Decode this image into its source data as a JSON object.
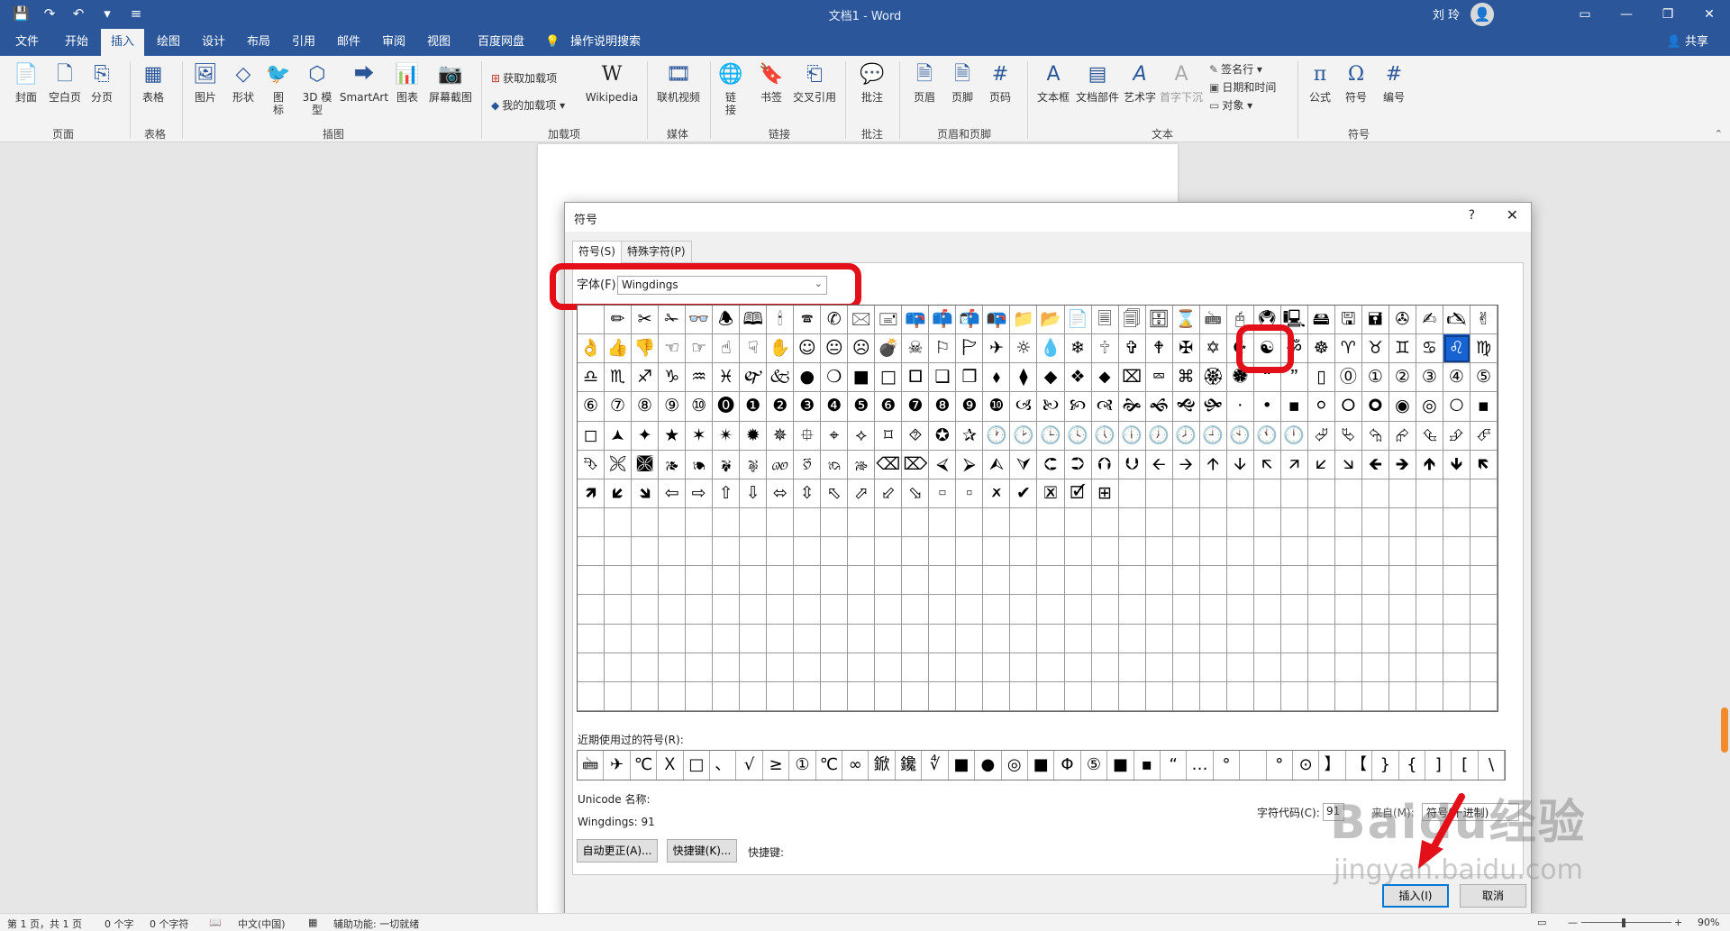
{
  "titlebar": {
    "qat": [
      "💾",
      "↷",
      "↶",
      "▾",
      "≡"
    ],
    "doc_title": "文档1  -  Word",
    "user": "刘 玲",
    "avatar_icon": "👤",
    "window_buttons": [
      "▭",
      "—",
      "❐",
      "✕"
    ]
  },
  "tabs": [
    {
      "label": "文件"
    },
    {
      "label": "开始"
    },
    {
      "label": "插入"
    },
    {
      "label": "绘图"
    },
    {
      "label": "设计"
    },
    {
      "label": "布局"
    },
    {
      "label": "引用"
    },
    {
      "label": "邮件"
    },
    {
      "label": "审阅"
    },
    {
      "label": "视图"
    },
    {
      "label": "百度网盘"
    }
  ],
  "tell_me": "操作说明搜索",
  "share": "共享",
  "ribbon": {
    "buttons": {
      "cover": "封面",
      "blank": "空白页",
      "break": "分页",
      "table": "表格",
      "picture": "图片",
      "shapes": "形状",
      "icons": "图\n标",
      "model3d": "3D 模\n型",
      "smartart": "SmartArt",
      "chart": "图表",
      "screenshot": "屏幕截图",
      "get_addins": "获取加载项",
      "my_addins": "我的加载项",
      "wikipedia": "Wikipedia",
      "online_video": "联机视频",
      "link": "链\n接",
      "bookmark": "书签",
      "crossref": "交叉引用",
      "comment": "批注",
      "header": "页眉",
      "footer": "页脚",
      "pagenum": "页码",
      "textbox": "文本框",
      "quickparts": "文档部件",
      "wordart": "艺术字",
      "dropcap": "首字下沉",
      "signature": "签名行",
      "datetime": "日期和时间",
      "object": "对象",
      "equation": "公式",
      "symbol": "符号",
      "number": "编号"
    },
    "groups": {
      "pages": "页面",
      "tables": "表格",
      "illustrations": "插图",
      "addins": "加载项",
      "media": "媒体",
      "links": "链接",
      "comments": "批注",
      "headerfooter": "页眉和页脚",
      "text": "文本",
      "symbols": "符号"
    }
  },
  "dialog": {
    "title": "符号",
    "help": "?",
    "close": "✕",
    "tabs": [
      "符号(S)",
      "特殊字符(P)"
    ],
    "font_label": "字体(F):",
    "font_value": "Wingdings",
    "symbols": [
      "",
      "✏",
      "✂",
      "✁",
      "👓",
      "🕭",
      "🕮",
      "🕯",
      "🕿",
      "✆",
      "🖂",
      "🖃",
      "📪",
      "📫",
      "📬",
      "📭",
      "📁",
      "📂",
      "📄",
      "🗏",
      "🗐",
      "🗄",
      "⌛",
      "🖮",
      "🖰",
      "🖲",
      "🖳",
      "🖴",
      "🖫",
      "🖬",
      "✇",
      "✍",
      "🖎",
      "✌",
      "👌",
      "👍",
      "👎",
      "☜",
      "☞",
      "☝",
      "☟",
      "✋",
      "☺",
      "😐",
      "☹",
      "💣",
      "☠",
      "⚐",
      "🏱",
      "✈",
      "☼",
      "💧",
      "❄",
      "🕆",
      "✞",
      "🕈",
      "✠",
      "✡",
      "☪",
      "☯",
      "ॐ",
      "☸",
      "♈",
      "♉",
      "♊",
      "♋",
      "♌",
      "♍",
      "♎",
      "♏",
      "♐",
      "♑",
      "♒",
      "♓",
      "🙰",
      "🙵",
      "●",
      "❍",
      "■",
      "□",
      "🞐",
      "❑",
      "❒",
      "⬧",
      "⧫",
      "◆",
      "❖",
      "⬥",
      "⌧",
      "⮹",
      "⌘",
      "🏵",
      "🏶",
      "🙶",
      "🙷",
      "▯",
      "⓪",
      "①",
      "②",
      "③",
      "④",
      "⑤",
      "⑥",
      "⑦",
      "⑧",
      "⑨",
      "⑩",
      "⓿",
      "❶",
      "❷",
      "❸",
      "❹",
      "❺",
      "❻",
      "❼",
      "❽",
      "❾",
      "❿",
      "🙢",
      "🙠",
      "🙡",
      "🙣",
      "🙞",
      "🙜",
      "🙝",
      "🙟",
      "·",
      "•",
      "▪",
      "⚪",
      "🞆",
      "🞈",
      "◉",
      "◎",
      "🞅",
      "▪",
      "◻",
      "🟂",
      "✦",
      "★",
      "✶",
      "✴",
      "✹",
      "✵",
      "⯐",
      "⌖",
      "⟡",
      "⌑",
      "⯑",
      "✪",
      "✰",
      "🕐",
      "🕑",
      "🕒",
      "🕓",
      "🕔",
      "🕕",
      "🕖",
      "🕗",
      "🕘",
      "🕙",
      "🕚",
      "🕛",
      "⮰",
      "⮱",
      "⮲",
      "⮳",
      "⮴",
      "⮵",
      "⮶",
      "⮷",
      "🙪",
      "🙫",
      "🙕",
      "🙔",
      "🙗",
      "🙖",
      "🙐",
      "🙑",
      "🙒",
      "🙓",
      "⌫",
      "⌦",
      "⮘",
      "⮚",
      "⮙",
      "⮛",
      "⮈",
      "⮊",
      "⮉",
      "⮋",
      "🡨",
      "🡪",
      "🡩",
      "🡫",
      "🡬",
      "🡭",
      "🡯",
      "🡮",
      "🡸",
      "🡺",
      "🡹",
      "🡻",
      "🡼",
      "🡽",
      "🡿",
      "🡾",
      "⇦",
      "⇨",
      "⇧",
      "⇩",
      "⬄",
      "⇳",
      "⬁",
      "⬀",
      "⬃",
      "⬂",
      "🢬",
      "🢭",
      "🗶",
      "✔",
      "🗷",
      "🗹",
      "⊞"
    ],
    "selected_index": 66,
    "recent_label": "近期使用过的符号(R):",
    "recent": [
      "🖮",
      "✈",
      "℃",
      "Ｘ",
      "□",
      "、",
      "√",
      "≥",
      "①",
      "℃",
      "∞",
      "鍁",
      "鑱",
      "∜",
      "■",
      "●",
      "◎",
      "■",
      "Φ",
      "⑤",
      "■",
      "▪",
      "“",
      "…",
      "°",
      "",
      "°",
      "⊙",
      "】",
      "【",
      "}",
      "{",
      "]",
      "[",
      "\\"
    ],
    "unicode_name_label": "Unicode 名称:",
    "unicode_value": "Wingdings: 91",
    "charcode_label": "字符代码(C):",
    "charcode_value": "91",
    "from_label": "来自(M):",
    "from_value": "符号(十进制)",
    "autocorrect": "自动更正(A)...",
    "shortcut_btn": "快捷键(K)...",
    "shortcut_label": "快捷键:",
    "insert": "插入(I)",
    "cancel": "取消"
  },
  "statusbar": {
    "page": "第 1 页，共 1 页",
    "words": "0 个字",
    "chars": "0 个字符",
    "lang": "中文(中国)",
    "accessibility": "辅助功能: 一切就绪",
    "zoom": "90%"
  },
  "watermark": {
    "text": "Baidu经验",
    "url": "jingyan.baidu.com"
  }
}
